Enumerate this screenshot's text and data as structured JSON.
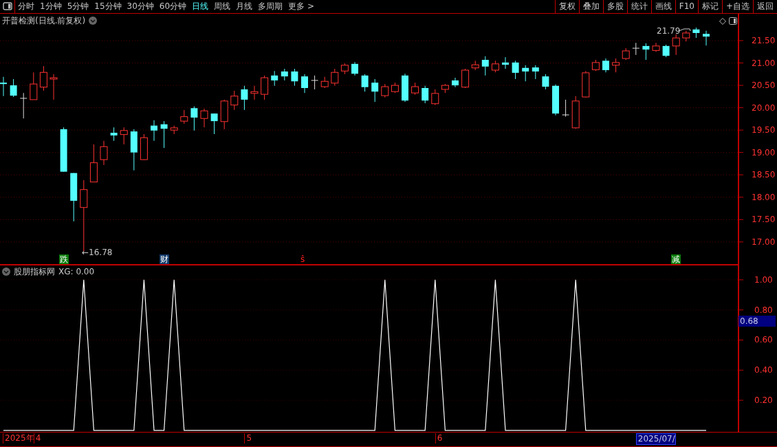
{
  "toolbar": {
    "periods": [
      {
        "label": "分时",
        "selected": false
      },
      {
        "label": "1分钟",
        "selected": false
      },
      {
        "label": "5分钟",
        "selected": false
      },
      {
        "label": "15分钟",
        "selected": false
      },
      {
        "label": "30分钟",
        "selected": false
      },
      {
        "label": "60分钟",
        "selected": false
      },
      {
        "label": "日线",
        "selected": true
      },
      {
        "label": "周线",
        "selected": false
      },
      {
        "label": "月线",
        "selected": false
      },
      {
        "label": "多周期",
        "selected": false
      },
      {
        "label": "更多 >",
        "selected": false
      }
    ],
    "actions": [
      "复权",
      "叠加",
      "多股",
      "统计",
      "画线",
      "F10",
      "标记",
      "+自选",
      "返回"
    ]
  },
  "price_panel": {
    "title": "开普检测(日线.前复权)",
    "high_label": "21.79",
    "low_label": "←16.78",
    "event_marks": [
      {
        "text": "跌",
        "kind": "green"
      },
      {
        "text": "财",
        "kind": "blue"
      },
      {
        "text": "ŝ",
        "kind": "red"
      },
      {
        "text": "减",
        "kind": "green"
      }
    ],
    "chart_data": {
      "type": "candlestick",
      "ylim": [
        16.49,
        22.1
      ],
      "grid": true,
      "yticks": [
        {
          "value": 21.5,
          "label": "21.50"
        },
        {
          "value": 21.0,
          "label": "21.00"
        },
        {
          "value": 20.5,
          "label": "20.50"
        },
        {
          "value": 20.0,
          "label": "20.00"
        },
        {
          "value": 19.5,
          "label": "19.50"
        },
        {
          "value": 19.0,
          "label": "19.00"
        },
        {
          "value": 18.5,
          "label": "18.50"
        },
        {
          "value": 18.0,
          "label": "18.00"
        },
        {
          "value": 17.5,
          "label": "17.50"
        },
        {
          "value": 17.0,
          "label": "17.00"
        }
      ],
      "ohlc": [
        [
          20.56,
          20.69,
          20.26,
          20.53
        ],
        [
          20.5,
          20.64,
          20.24,
          20.27
        ],
        [
          20.21,
          20.33,
          19.76,
          20.21
        ],
        [
          20.18,
          20.79,
          20.18,
          20.53
        ],
        [
          20.46,
          20.93,
          20.38,
          20.79
        ],
        [
          20.64,
          20.75,
          20.18,
          20.67
        ],
        [
          19.52,
          19.56,
          18.57,
          18.57
        ],
        [
          18.54,
          18.54,
          17.46,
          17.92
        ],
        [
          17.77,
          18.38,
          16.78,
          18.17
        ],
        [
          18.34,
          19.18,
          18.34,
          18.77
        ],
        [
          18.84,
          19.26,
          18.72,
          19.13
        ],
        [
          19.44,
          19.56,
          19.26,
          19.38
        ],
        [
          19.4,
          19.56,
          19.18,
          19.49
        ],
        [
          19.47,
          19.52,
          18.6,
          19.0
        ],
        [
          18.84,
          19.41,
          18.83,
          19.33
        ],
        [
          19.6,
          19.72,
          19.26,
          19.49
        ],
        [
          19.63,
          19.7,
          19.1,
          19.53
        ],
        [
          19.5,
          19.6,
          19.41,
          19.55
        ],
        [
          19.7,
          19.95,
          19.64,
          19.8
        ],
        [
          19.99,
          20.03,
          19.49,
          19.78
        ],
        [
          19.76,
          19.98,
          19.56,
          19.93
        ],
        [
          19.87,
          19.87,
          19.41,
          19.7
        ],
        [
          19.69,
          20.18,
          19.52,
          20.15
        ],
        [
          20.06,
          20.38,
          19.95,
          20.26
        ],
        [
          20.41,
          20.49,
          19.95,
          20.18
        ],
        [
          20.32,
          20.49,
          20.18,
          20.36
        ],
        [
          20.3,
          20.72,
          20.18,
          20.67
        ],
        [
          20.72,
          20.82,
          20.49,
          20.61
        ],
        [
          20.81,
          20.87,
          20.61,
          20.7
        ],
        [
          20.81,
          20.87,
          20.49,
          20.59
        ],
        [
          20.7,
          20.75,
          20.33,
          20.44
        ],
        [
          20.61,
          20.72,
          20.41,
          20.61
        ],
        [
          20.47,
          20.69,
          20.44,
          20.59
        ],
        [
          20.55,
          20.87,
          20.49,
          20.79
        ],
        [
          20.82,
          20.99,
          20.75,
          20.95
        ],
        [
          20.98,
          21.02,
          20.72,
          20.76
        ],
        [
          20.72,
          20.75,
          20.36,
          20.46
        ],
        [
          20.56,
          20.64,
          20.13,
          20.36
        ],
        [
          20.27,
          20.53,
          20.23,
          20.47
        ],
        [
          20.36,
          20.56,
          20.33,
          20.5
        ],
        [
          20.72,
          20.76,
          20.13,
          20.16
        ],
        [
          20.33,
          20.56,
          20.29,
          20.47
        ],
        [
          20.44,
          20.49,
          20.1,
          20.16
        ],
        [
          20.09,
          20.41,
          20.06,
          20.32
        ],
        [
          20.41,
          20.53,
          20.33,
          20.5
        ],
        [
          20.61,
          20.67,
          20.46,
          20.5
        ],
        [
          20.46,
          20.87,
          20.44,
          20.84
        ],
        [
          20.89,
          21.05,
          20.84,
          20.96
        ],
        [
          21.07,
          21.15,
          20.72,
          20.92
        ],
        [
          20.84,
          21.05,
          20.79,
          20.98
        ],
        [
          21.01,
          21.13,
          20.87,
          20.96
        ],
        [
          21.01,
          21.05,
          20.64,
          20.78
        ],
        [
          20.89,
          20.95,
          20.59,
          20.81
        ],
        [
          20.9,
          20.95,
          20.64,
          20.81
        ],
        [
          20.7,
          20.75,
          20.41,
          20.47
        ],
        [
          20.49,
          20.52,
          19.83,
          19.87
        ],
        [
          19.84,
          20.18,
          19.8,
          19.84
        ],
        [
          19.55,
          20.26,
          19.53,
          20.15
        ],
        [
          20.24,
          20.82,
          20.23,
          20.78
        ],
        [
          20.85,
          21.07,
          20.82,
          21.01
        ],
        [
          21.05,
          21.1,
          20.79,
          20.84
        ],
        [
          20.95,
          21.1,
          20.79,
          21.01
        ],
        [
          21.1,
          21.33,
          21.07,
          21.27
        ],
        [
          21.33,
          21.45,
          21.18,
          21.33
        ],
        [
          21.38,
          21.44,
          21.07,
          21.3
        ],
        [
          21.28,
          21.45,
          21.25,
          21.38
        ],
        [
          21.38,
          21.41,
          21.13,
          21.16
        ],
        [
          21.38,
          21.64,
          21.18,
          21.56
        ],
        [
          21.56,
          21.72,
          21.48,
          21.67
        ],
        [
          21.75,
          21.79,
          21.56,
          21.67
        ],
        [
          21.65,
          21.72,
          21.39,
          21.59
        ]
      ]
    }
  },
  "indicator_panel": {
    "title": "股朋指标网",
    "reading": "XG: 0.00",
    "value_tag": "0.68",
    "chart_data": {
      "type": "line",
      "ylim": [
        -0.01,
        1.1
      ],
      "grid": true,
      "yticks": [
        {
          "value": 1.0,
          "label": "1.00"
        },
        {
          "value": 0.8,
          "label": "0.80"
        },
        {
          "value": 0.6,
          "label": "0.60"
        },
        {
          "value": 0.4,
          "label": "0.40"
        },
        {
          "value": 0.2,
          "label": "0.20"
        }
      ],
      "series": [
        {
          "color": "#ffffff",
          "values": [
            0,
            0,
            0,
            0,
            0,
            0,
            0,
            0,
            1,
            0,
            0,
            0,
            0,
            0,
            1,
            0,
            0,
            1,
            0,
            0,
            0,
            0,
            0,
            0,
            0,
            0,
            0,
            0,
            0,
            0,
            0,
            0,
            0,
            0,
            0,
            0,
            0,
            0,
            1,
            0,
            0,
            0,
            0,
            1,
            0,
            0,
            0,
            0,
            0,
            1,
            0,
            0,
            0,
            0,
            0,
            0,
            0,
            1,
            0,
            0,
            0,
            0,
            0,
            0,
            0,
            0,
            0,
            0,
            0,
            0,
            0
          ]
        }
      ]
    }
  },
  "time_axis": [
    "2025年",
    "4",
    "5",
    "6",
    "2025/07/"
  ]
}
